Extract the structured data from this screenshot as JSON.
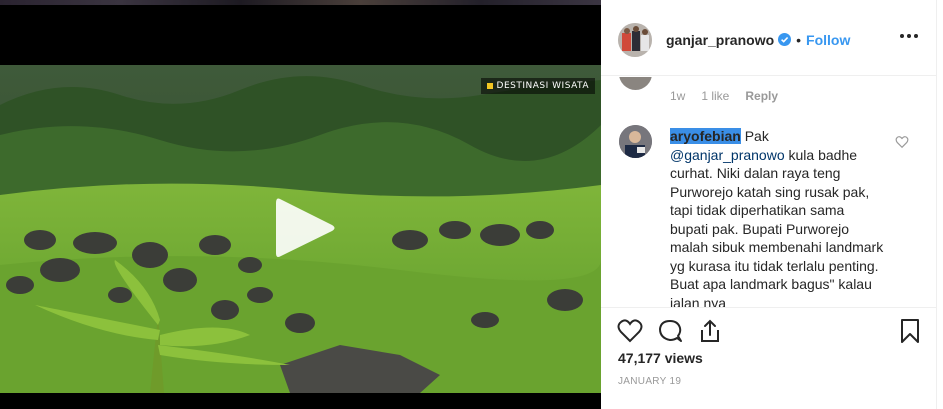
{
  "media": {
    "watermark": "DESTINASI WISATA",
    "play_icon": "play-icon"
  },
  "header": {
    "username": "ganjar_pranowo",
    "verified_icon": "verified-badge-icon",
    "separator": "•",
    "follow_label": "Follow",
    "more_icon": "more-options-icon"
  },
  "previous_comment": {
    "age": "1w",
    "likes": "1 like",
    "reply_label": "Reply"
  },
  "comment": {
    "username": "aryofebian",
    "text_before": " Pak ",
    "mention": "@ganjar_pranowo",
    "text_after": " kula badhe curhat. Niki dalan raya teng Purworejo katah sing rusak pak, tapi tidak diperhatikan sama bupati pak. Bupati Purworejo malah sibuk membenahi landmark yg kurasa itu tidak terlalu penting. Buat apa landmark bagus\" kalau jalan nya",
    "like_icon": "heart-outline-icon"
  },
  "actions": {
    "like_icon": "heart-icon",
    "comment_icon": "comment-icon",
    "share_icon": "share-icon",
    "save_icon": "bookmark-icon"
  },
  "stats": {
    "views": "47,177 views",
    "date": "JANUARY 19"
  },
  "colors": {
    "follow": "#3897f0",
    "highlight": "#3a8ee6",
    "mention": "#003569",
    "muted": "#999999"
  }
}
